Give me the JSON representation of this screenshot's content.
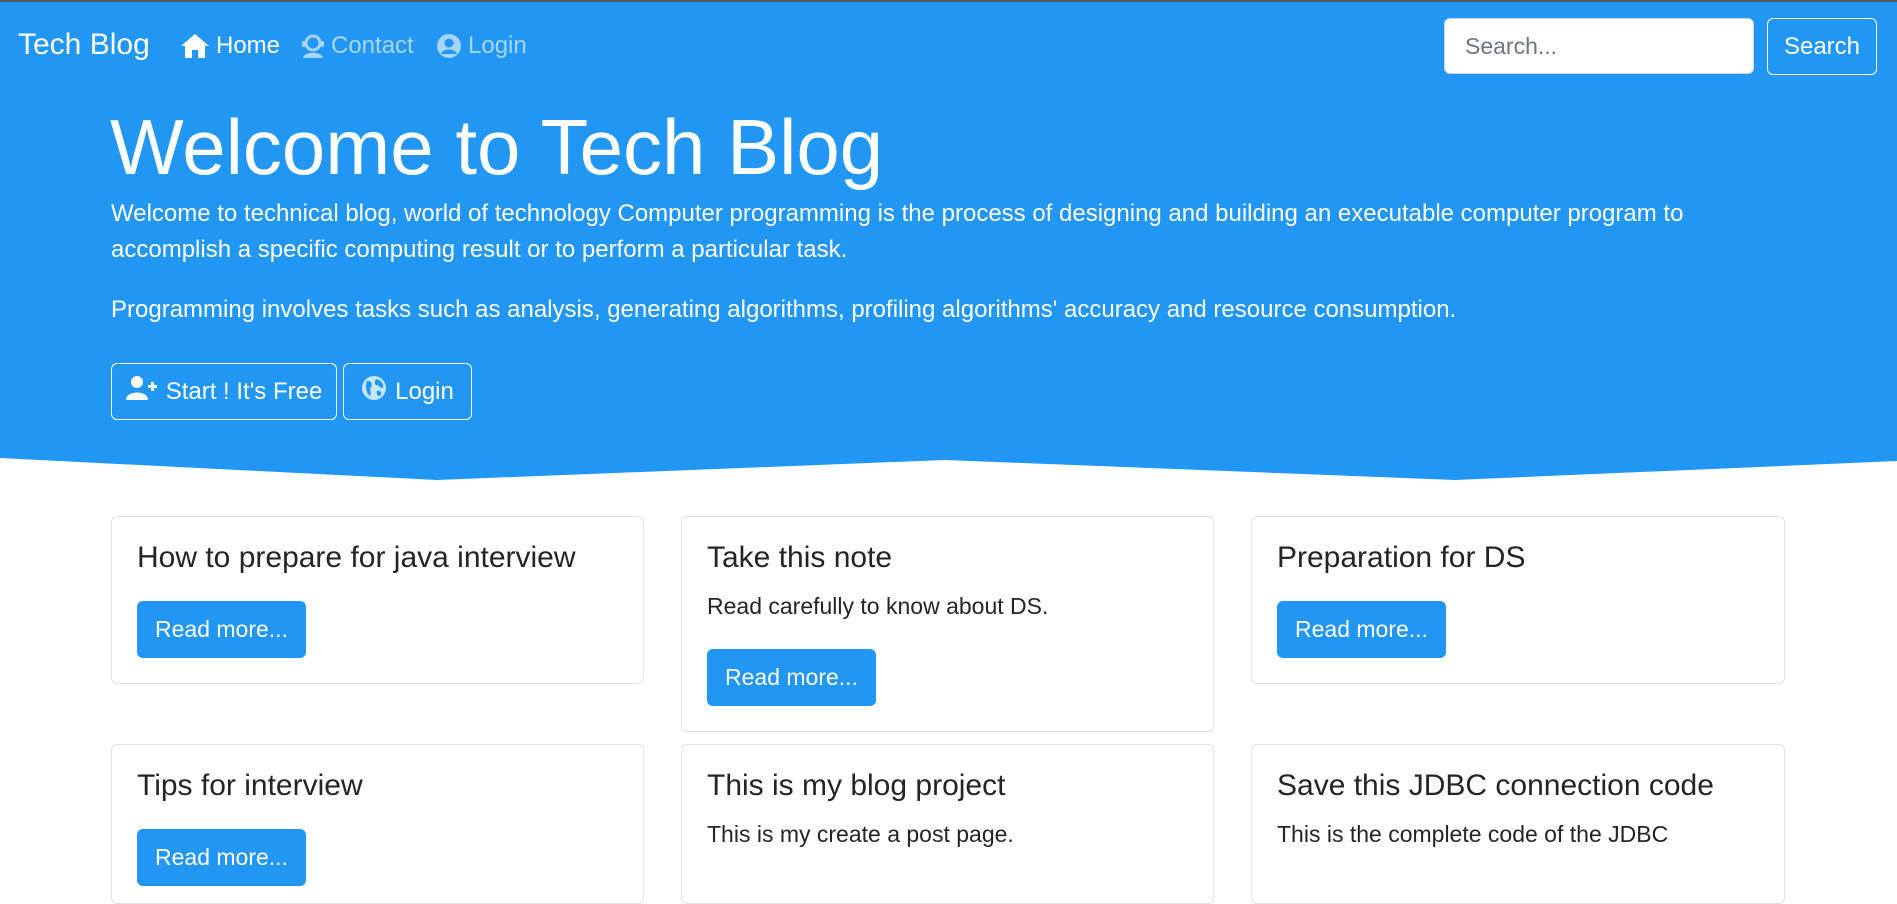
{
  "colors": {
    "primary": "#2196f3",
    "text": "#212529",
    "card_border": "#dee2e6"
  },
  "navbar": {
    "brand": "Tech Blog",
    "links": [
      {
        "label": "Home",
        "icon": "home-icon",
        "active": true
      },
      {
        "label": "Contact",
        "icon": "contact-support-icon",
        "active": false
      },
      {
        "label": "Login",
        "icon": "user-circle-icon",
        "active": false
      }
    ],
    "search": {
      "placeholder": "Search...",
      "value": "",
      "button_label": "Search"
    }
  },
  "hero": {
    "title": "Welcome to Tech Blog",
    "paragraph1": "Welcome to technical blog, world of technology Computer programming is the process of designing and building an executable computer program to accomplish a specific computing result or to perform a particular task.",
    "paragraph2": "Programming involves tasks such as analysis, generating algorithms, profiling algorithms' accuracy and resource consumption.",
    "buttons": [
      {
        "label": "Start ! It's Free",
        "icon": "user-plus-icon"
      },
      {
        "label": "Login",
        "icon": "globe-icon"
      }
    ]
  },
  "posts": [
    {
      "title": "How to prepare for java interview",
      "text": "",
      "button_label": "Read more..."
    },
    {
      "title": "Take this note",
      "text": "Read carefully to know about DS.",
      "button_label": "Read more..."
    },
    {
      "title": "Preparation for DS",
      "text": "",
      "button_label": "Read more..."
    },
    {
      "title": "Tips for interview",
      "text": "",
      "button_label": "Read more..."
    },
    {
      "title": "This is my blog project",
      "text": "This is my create a post page.",
      "button_label": "Read more..."
    },
    {
      "title": "Save this JDBC connection code",
      "text": "This is the complete code of the JDBC",
      "button_label": "Read more..."
    }
  ]
}
